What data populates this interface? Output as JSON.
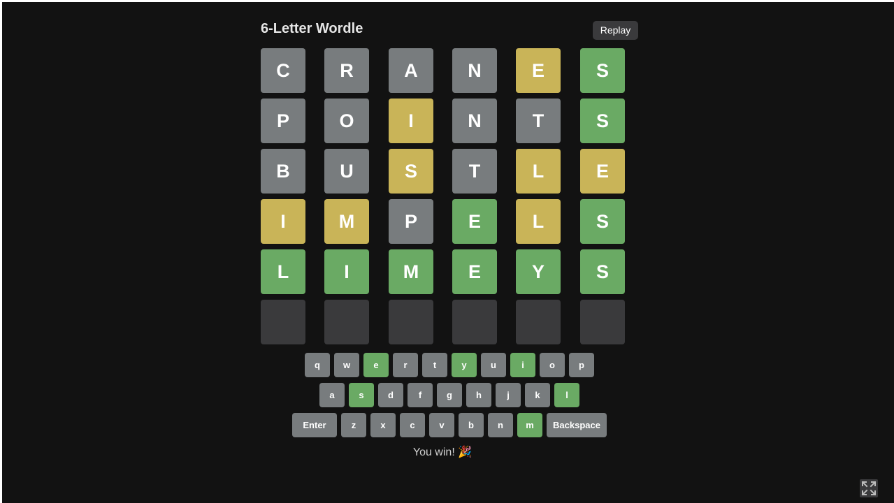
{
  "title": "6-Letter Wordle",
  "replay_label": "Replay",
  "board": [
    [
      {
        "l": "C",
        "s": "absent"
      },
      {
        "l": "R",
        "s": "absent"
      },
      {
        "l": "A",
        "s": "absent"
      },
      {
        "l": "N",
        "s": "absent"
      },
      {
        "l": "E",
        "s": "present"
      },
      {
        "l": "S",
        "s": "correct"
      }
    ],
    [
      {
        "l": "P",
        "s": "absent"
      },
      {
        "l": "O",
        "s": "absent"
      },
      {
        "l": "I",
        "s": "present"
      },
      {
        "l": "N",
        "s": "absent"
      },
      {
        "l": "T",
        "s": "absent"
      },
      {
        "l": "S",
        "s": "correct"
      }
    ],
    [
      {
        "l": "B",
        "s": "absent"
      },
      {
        "l": "U",
        "s": "absent"
      },
      {
        "l": "S",
        "s": "present"
      },
      {
        "l": "T",
        "s": "absent"
      },
      {
        "l": "L",
        "s": "present"
      },
      {
        "l": "E",
        "s": "present"
      }
    ],
    [
      {
        "l": "I",
        "s": "present"
      },
      {
        "l": "M",
        "s": "present"
      },
      {
        "l": "P",
        "s": "absent"
      },
      {
        "l": "E",
        "s": "correct"
      },
      {
        "l": "L",
        "s": "present"
      },
      {
        "l": "S",
        "s": "correct"
      }
    ],
    [
      {
        "l": "L",
        "s": "correct"
      },
      {
        "l": "I",
        "s": "correct"
      },
      {
        "l": "M",
        "s": "correct"
      },
      {
        "l": "E",
        "s": "correct"
      },
      {
        "l": "Y",
        "s": "correct"
      },
      {
        "l": "S",
        "s": "correct"
      }
    ],
    [
      {
        "l": "",
        "s": "empty"
      },
      {
        "l": "",
        "s": "empty"
      },
      {
        "l": "",
        "s": "empty"
      },
      {
        "l": "",
        "s": "empty"
      },
      {
        "l": "",
        "s": "empty"
      },
      {
        "l": "",
        "s": "empty"
      }
    ]
  ],
  "keyboard": [
    [
      {
        "k": "q",
        "s": "absent"
      },
      {
        "k": "w",
        "s": "absent"
      },
      {
        "k": "e",
        "s": "correct"
      },
      {
        "k": "r",
        "s": "absent"
      },
      {
        "k": "t",
        "s": "absent"
      },
      {
        "k": "y",
        "s": "correct"
      },
      {
        "k": "u",
        "s": "absent"
      },
      {
        "k": "i",
        "s": "correct"
      },
      {
        "k": "o",
        "s": "absent"
      },
      {
        "k": "p",
        "s": "absent"
      }
    ],
    [
      {
        "k": "a",
        "s": "absent"
      },
      {
        "k": "s",
        "s": "correct"
      },
      {
        "k": "d",
        "s": "absent"
      },
      {
        "k": "f",
        "s": "absent"
      },
      {
        "k": "g",
        "s": "absent"
      },
      {
        "k": "h",
        "s": "absent"
      },
      {
        "k": "j",
        "s": "absent"
      },
      {
        "k": "k",
        "s": "absent"
      },
      {
        "k": "l",
        "s": "correct"
      }
    ],
    [
      {
        "k": "Enter",
        "s": "absent"
      },
      {
        "k": "z",
        "s": "absent"
      },
      {
        "k": "x",
        "s": "absent"
      },
      {
        "k": "c",
        "s": "absent"
      },
      {
        "k": "v",
        "s": "absent"
      },
      {
        "k": "b",
        "s": "absent"
      },
      {
        "k": "n",
        "s": "absent"
      },
      {
        "k": "m",
        "s": "correct"
      },
      {
        "k": "Backspace",
        "s": "absent"
      }
    ]
  ],
  "status_text": "You win! 🎉",
  "colors": {
    "background": "#121212",
    "absent": "#787c7e",
    "present": "#c9b458",
    "correct": "#6aaa64",
    "empty": "#3a3a3c",
    "key_default": "#818384"
  },
  "icons": {
    "fullscreen": "fullscreen-icon",
    "celebration": "party-popper"
  }
}
